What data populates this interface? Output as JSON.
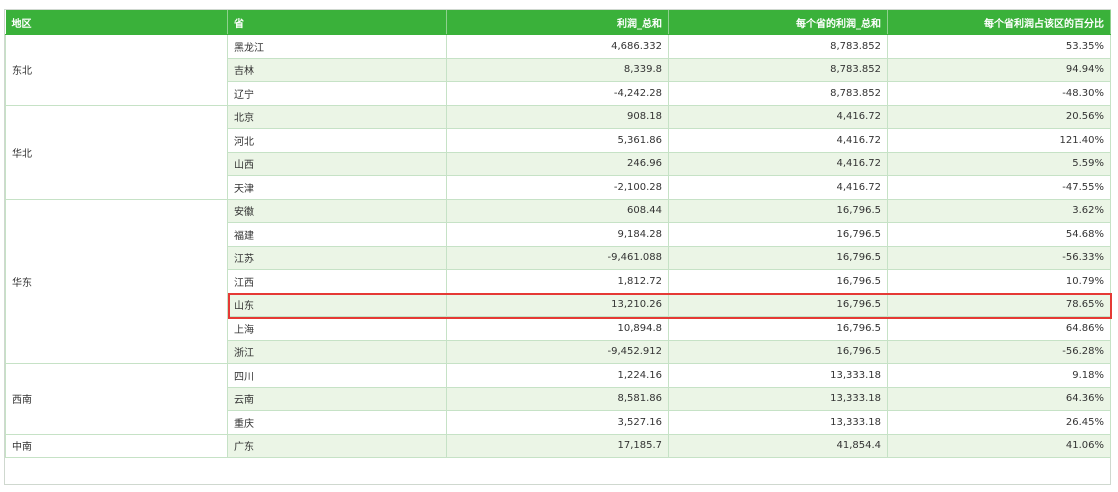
{
  "table": {
    "headers": [
      "地区",
      "省",
      "利润_总和",
      "每个省的利润_总和",
      "每个省利润占该区的百分比"
    ],
    "groups": [
      {
        "region": "东北",
        "rows": [
          {
            "province": "黑龙江",
            "profit": "4,686.332",
            "province_total": "8,783.852",
            "pct": "53.35%"
          },
          {
            "province": "吉林",
            "profit": "8,339.8",
            "province_total": "8,783.852",
            "pct": "94.94%"
          },
          {
            "province": "辽宁",
            "profit": "-4,242.28",
            "province_total": "8,783.852",
            "pct": "-48.30%"
          }
        ]
      },
      {
        "region": "华北",
        "rows": [
          {
            "province": "北京",
            "profit": "908.18",
            "province_total": "4,416.72",
            "pct": "20.56%"
          },
          {
            "province": "河北",
            "profit": "5,361.86",
            "province_total": "4,416.72",
            "pct": "121.40%"
          },
          {
            "province": "山西",
            "profit": "246.96",
            "province_total": "4,416.72",
            "pct": "5.59%"
          },
          {
            "province": "天津",
            "profit": "-2,100.28",
            "province_total": "4,416.72",
            "pct": "-47.55%"
          }
        ]
      },
      {
        "region": "华东",
        "rows": [
          {
            "province": "安徽",
            "profit": "608.44",
            "province_total": "16,796.5",
            "pct": "3.62%"
          },
          {
            "province": "福建",
            "profit": "9,184.28",
            "province_total": "16,796.5",
            "pct": "54.68%"
          },
          {
            "province": "江苏",
            "profit": "-9,461.088",
            "province_total": "16,796.5",
            "pct": "-56.33%"
          },
          {
            "province": "江西",
            "profit": "1,812.72",
            "province_total": "16,796.5",
            "pct": "10.79%"
          },
          {
            "province": "山东",
            "profit": "13,210.26",
            "province_total": "16,796.5",
            "pct": "78.65%",
            "highlighted": true
          },
          {
            "province": "上海",
            "profit": "10,894.8",
            "province_total": "16,796.5",
            "pct": "64.86%"
          },
          {
            "province": "浙江",
            "profit": "-9,452.912",
            "province_total": "16,796.5",
            "pct": "-56.28%"
          }
        ]
      },
      {
        "region": "西南",
        "rows": [
          {
            "province": "四川",
            "profit": "1,224.16",
            "province_total": "13,333.18",
            "pct": "9.18%"
          },
          {
            "province": "云南",
            "profit": "8,581.86",
            "province_total": "13,333.18",
            "pct": "64.36%"
          },
          {
            "province": "重庆",
            "profit": "3,527.16",
            "province_total": "13,333.18",
            "pct": "26.45%"
          }
        ]
      },
      {
        "region": "中南",
        "rows": [
          {
            "province": "广东",
            "profit": "17,185.7",
            "province_total": "41,854.4",
            "pct": "41.06%"
          }
        ]
      }
    ]
  },
  "colors": {
    "header_bg": "#3ab13a",
    "stripe_bg": "#ebf5e6",
    "highlight_border": "#e53935"
  }
}
